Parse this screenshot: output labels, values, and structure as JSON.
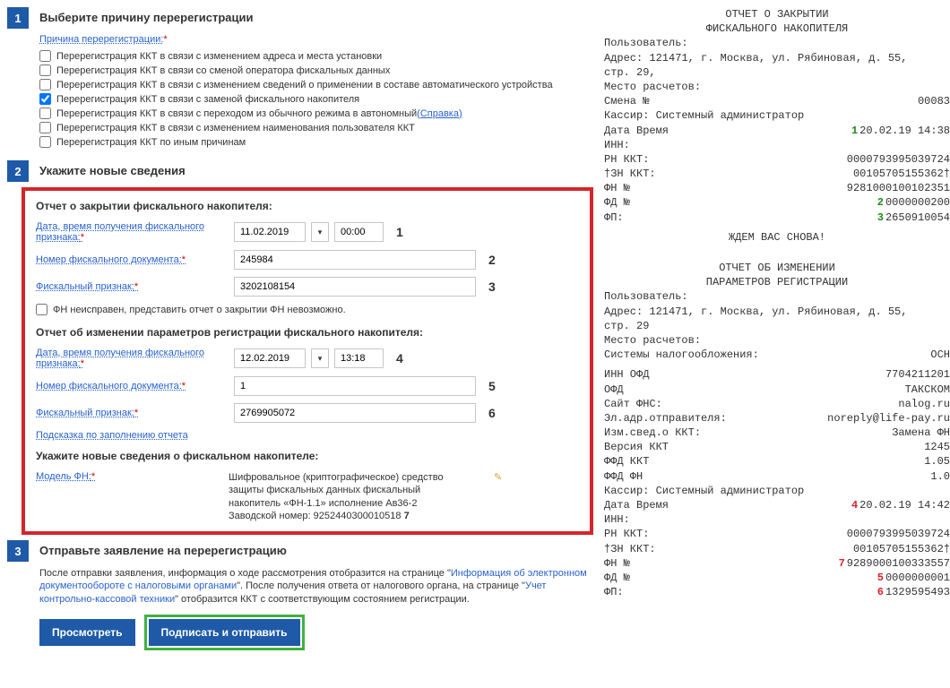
{
  "step1": {
    "num": "1",
    "title": "Выберите причину перерегистрации",
    "reason_label": "Причина перерегистрации:",
    "options": [
      {
        "checked": false,
        "text": "Перерегистрация ККТ в связи с изменением адреса и места установки"
      },
      {
        "checked": false,
        "text": "Перерегистрация ККТ в связи со сменой оператора фискальных данных"
      },
      {
        "checked": false,
        "text": "Перерегистрация ККТ в связи с изменением сведений о применении в составе автоматического устройства"
      },
      {
        "checked": true,
        "text": "Перерегистрация ККТ в связи с заменой фискального накопителя"
      },
      {
        "checked": false,
        "text": "Перерегистрация ККТ в связи с переходом из обычного режима в автономный",
        "help": "(Справка)"
      },
      {
        "checked": false,
        "text": "Перерегистрация ККТ в связи с изменением наименования пользователя ККТ"
      },
      {
        "checked": false,
        "text": "Перерегистрация ККТ по иным причинам"
      }
    ]
  },
  "step2": {
    "num": "2",
    "title": "Укажите новые сведения",
    "close_report": {
      "heading": "Отчет о закрытии фискального накопителя:",
      "datetime_label": "Дата, время получения фискального признака:",
      "date": "11.02.2019",
      "time": "00:00",
      "tag": "1",
      "docnum_label": "Номер фискального документа:",
      "docnum": "245984",
      "docnum_tag": "2",
      "fp_label": "Фискальный признак:",
      "fp": "3202108154",
      "fp_tag": "3",
      "bad_fn": "ФН неисправен, представить отчет о закрытии ФН невозможно."
    },
    "change_report": {
      "heading": "Отчет об изменении параметров регистрации фискального накопителя:",
      "datetime_label": "Дата, время получения фискального признака:",
      "date": "12.02.2019",
      "time": "13:18",
      "tag": "4",
      "docnum_label": "Номер фискального документа:",
      "docnum": "1",
      "docnum_tag": "5",
      "fp_label": "Фискальный признак:",
      "fp": "2769905072",
      "fp_tag": "6",
      "hint": "Подсказка по заполнению отчета"
    },
    "new_fn": {
      "heading": "Укажите новые сведения о фискальном накопителе:",
      "model_label": "Модель ФН:",
      "desc_l1": "Шифровальное (криптографическое) средство",
      "desc_l2": "защиты фискальных данных фискальный",
      "desc_l3": "накопитель «ФН-1.1» исполнение Ав36-2",
      "desc_l4": "Заводской номер: 9252440300010518",
      "tag7": "7"
    }
  },
  "step3": {
    "num": "3",
    "title": "Отправьте заявление на перерегистрацию",
    "desc_a": "После отправки заявления, информация о ходе рассмотрения отобразится на странице \"",
    "link_a": "Информация об электронном документообороте с налоговыми органами",
    "desc_b": "\". После получения ответа от налогового органа, на странице \"",
    "link_b": "Учет контрольно-кассовой техники",
    "desc_c": "\" отобразится ККТ с соответствующим состоянием регистрации.",
    "btn_view": "Просмотреть",
    "btn_sign": "Подписать и отправить"
  },
  "receipt_close": {
    "title1": "ОТЧЕТ О ЗАКРЫТИИ",
    "title2": "ФИСКАЛЬНОГО НАКОПИТЕЛЯ",
    "user": "Пользователь:",
    "addr1": "Адрес: 121471, г. Москва, ул. Рябиновая, д. 55,",
    "addr2": "стр. 29,",
    "place": "Место расчетов:",
    "shift_l": "Смена №",
    "shift_r": "00083",
    "cashier": "Кассир: Системный администратор",
    "dt_l": "Дата Время",
    "dt_r": "20.02.19 14:38",
    "dt_tag": "1",
    "inn": "ИНН:",
    "rn_l": "РН ККТ:",
    "rn_r": "0000793995039724",
    "zn_l": "†ЗН ККТ:",
    "zn_r": "00105705155362†",
    "fn_l": "ФН №",
    "fn_r": "9281000100102351",
    "fd_l": "ФД №",
    "fd_r": "0000000200",
    "fd_tag": "2",
    "fp_l": "ФП:",
    "fp_r": "2650910054",
    "fp_tag": "3",
    "bye": "ЖДЕМ ВАС СНОВА!"
  },
  "receipt_change": {
    "title1": "ОТЧЕТ ОБ ИЗМЕНЕНИИ",
    "title2": "ПАРАМЕТРОВ РЕГИСТРАЦИИ",
    "user": "Пользователь:",
    "addr1": "Адрес: 121471, г. Москва, ул. Рябиновая, д. 55,",
    "addr2": "стр. 29",
    "place": "Место расчетов:",
    "tax_l": "Системы налогообложения:",
    "tax_r": "ОСН",
    "innofd_l": "ИНН ОФД",
    "innofd_r": "7704211201",
    "ofd_l": "ОФД",
    "ofd_r": "ТАКСКОМ",
    "fns_l": "Сайт ФНС:",
    "fns_r": "nalog.ru",
    "email_l": "Эл.адр.отправителя:",
    "email_r": "noreply@life-pay.ru",
    "izm_l": "Изм.свед.о ККТ:",
    "izm_r": "Замена ФН",
    "ver_l": "Версия ККТ",
    "ver_r": "1245",
    "ffdkkt_l": "ФФД ККТ",
    "ffdkkt_r": "1.05",
    "ffdfn_l": "ФФД ФН",
    "ffdfn_r": "1.0",
    "cashier": "Кассир: Системный администратор",
    "dt_l": "Дата Время",
    "dt_r": "20.02.19 14:42",
    "dt_tag": "4",
    "inn": "ИНН:",
    "rn_l": "РН ККТ:",
    "rn_r": "0000793995039724",
    "zn_l": "†ЗН ККТ:",
    "zn_r": "00105705155362†",
    "fn_l": "ФН №",
    "fn_r": "9289000100333557",
    "fn_tag": "7",
    "fd_l": "ФД №",
    "fd_r": "0000000001",
    "fd_tag": "5",
    "fp_l": "ФП:",
    "fp_r": "1329595493",
    "fp_tag": "6"
  }
}
